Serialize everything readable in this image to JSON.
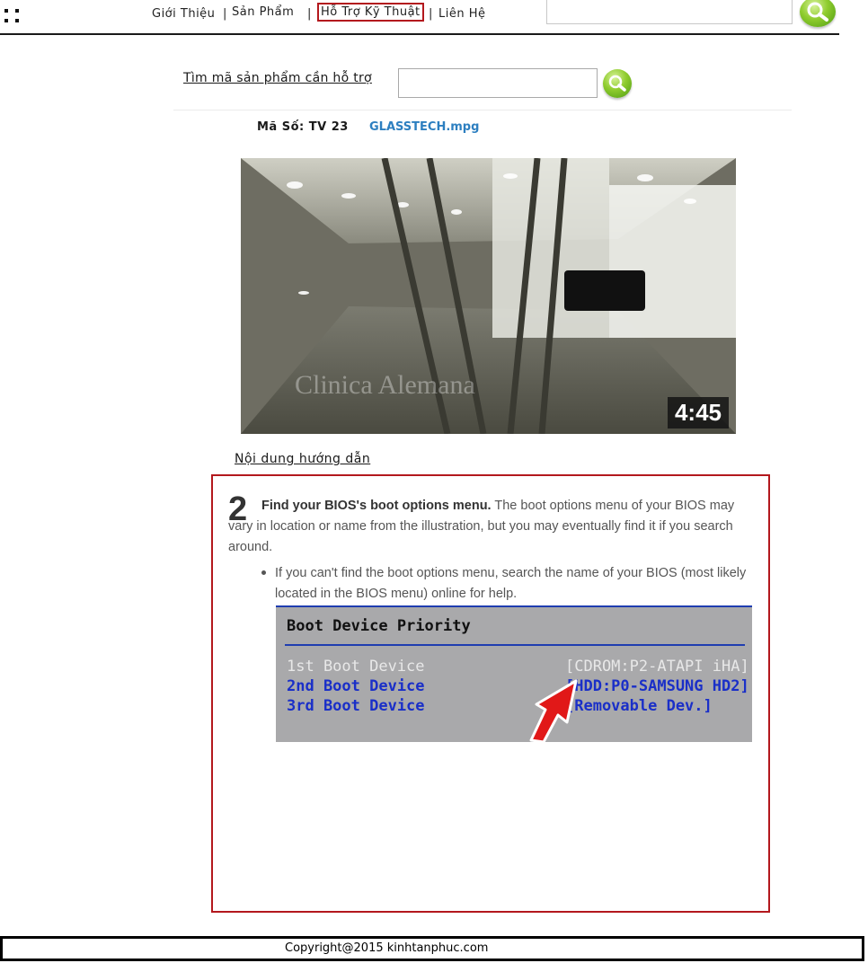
{
  "nav": {
    "items": [
      "Giới Thiệu",
      "Sản Phẩm",
      "Hỗ Trợ Kỹ Thuật",
      "Liên Hệ"
    ],
    "separator": "|",
    "active_index": 2
  },
  "search": {
    "label": "Tìm mã sản phẩm cần hỗ trợ"
  },
  "product": {
    "code_label": "Mã Số: TV 23",
    "file_name": "GLASSTECH.mpg"
  },
  "video": {
    "duration": "4:45",
    "watermark": "Clinica Alemana"
  },
  "guide": {
    "title": "Nội dung hướng dẫn",
    "step_number": "2",
    "step_heading": "Find your BIOS's boot options menu.",
    "step_body": "The boot options menu of your BIOS may vary in location or name from the illustration, but you may eventually find it if you search around.",
    "bullet": "If you can't find the boot options menu, search the name of your BIOS (most likely located in the BIOS menu) online for help."
  },
  "bios": {
    "title": "Boot Device Priority",
    "rows": [
      {
        "label": "1st Boot Device",
        "value": "[CDROM:P2-ATAPI iHA]"
      },
      {
        "label": "2nd Boot Device",
        "value": "[HDD:P0-SAMSUNG HD2]"
      },
      {
        "label": "3rd Boot Device",
        "value": "[Removable Dev.]"
      }
    ]
  },
  "footer": {
    "copyright": "Copyright@2015 kinhtanphuc.com"
  },
  "colors": {
    "accent_red": "#b3181d",
    "link_blue": "#2d7fc0",
    "bios_blue": "#1f3db0"
  }
}
